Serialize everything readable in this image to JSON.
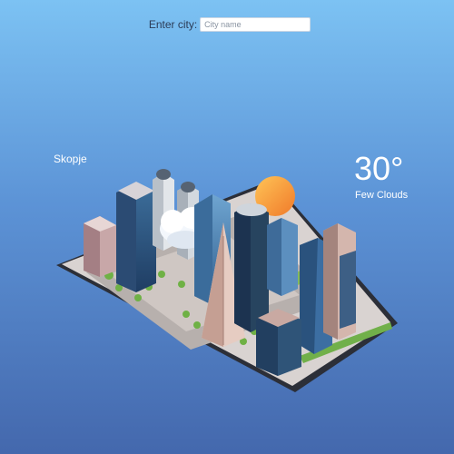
{
  "search": {
    "label": "Enter city:",
    "placeholder": "City name",
    "value": ""
  },
  "weather": {
    "city": "Skopje",
    "temperature": "30°",
    "condition": "Few Clouds",
    "icons": [
      "sun-icon",
      "cloud-icon"
    ]
  },
  "colors": {
    "sky_top": "#7cc2f3",
    "sky_bottom": "#4468ad",
    "text": "#ffffff",
    "sun": "#f7a13c"
  }
}
